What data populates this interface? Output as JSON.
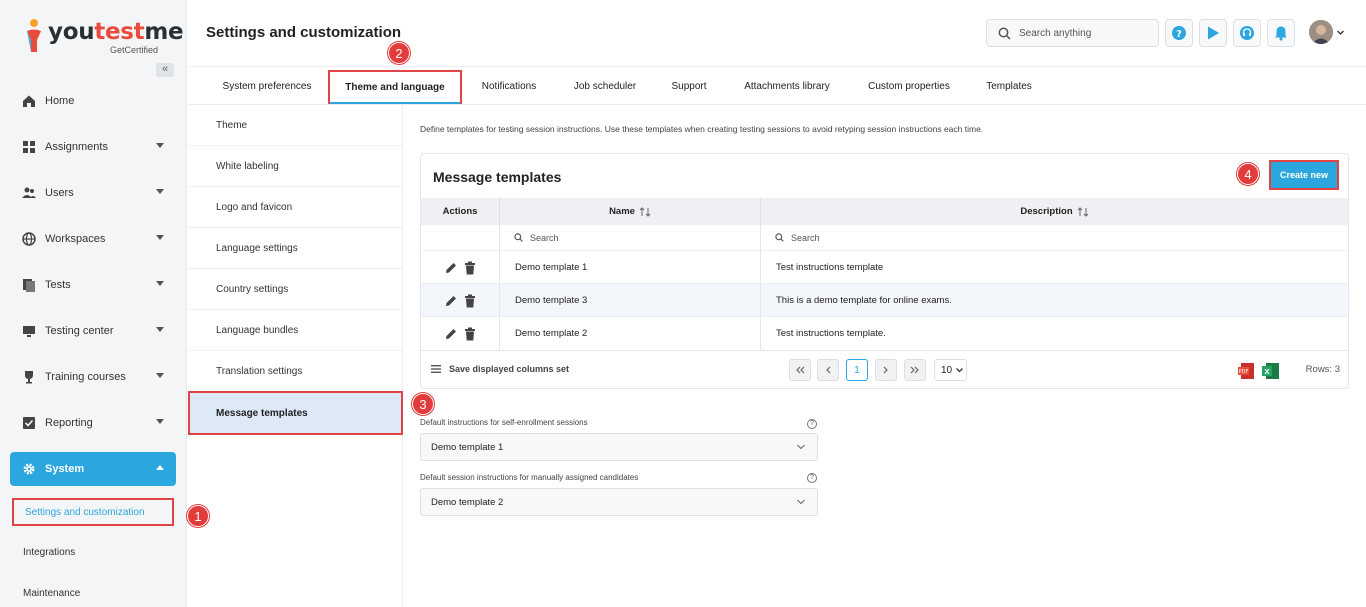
{
  "logo": {
    "text_a": "you",
    "text_b": "test",
    "text_c": "me",
    "sub": "GetCertified"
  },
  "sidebar": {
    "items": [
      {
        "label": "Home"
      },
      {
        "label": "Assignments"
      },
      {
        "label": "Users"
      },
      {
        "label": "Workspaces"
      },
      {
        "label": "Tests"
      },
      {
        "label": "Testing center"
      },
      {
        "label": "Training courses"
      },
      {
        "label": "Reporting"
      },
      {
        "label": "System"
      }
    ],
    "sub_items": [
      {
        "label": "Settings and customization"
      },
      {
        "label": "Integrations"
      },
      {
        "label": "Maintenance"
      }
    ]
  },
  "header": {
    "title": "Settings and customization",
    "search_placeholder": "Search anything"
  },
  "tabs": [
    {
      "label": "System preferences"
    },
    {
      "label": "Theme and language"
    },
    {
      "label": "Notifications"
    },
    {
      "label": "Job scheduler"
    },
    {
      "label": "Support"
    },
    {
      "label": "Attachments library"
    },
    {
      "label": "Custom properties"
    },
    {
      "label": "Templates"
    }
  ],
  "submenu": [
    {
      "label": "Theme"
    },
    {
      "label": "White labeling"
    },
    {
      "label": "Logo and favicon"
    },
    {
      "label": "Language settings"
    },
    {
      "label": "Country settings"
    },
    {
      "label": "Language bundles"
    },
    {
      "label": "Translation settings"
    },
    {
      "label": "Message templates"
    }
  ],
  "main": {
    "intro": "Define templates for testing session instructions. Use these templates when creating testing sessions to avoid retyping session instructions each time.",
    "panel_title": "Message templates",
    "create_label": "Create new",
    "columns": {
      "actions": "Actions",
      "name": "Name",
      "description": "Description"
    },
    "filter_placeholder": "Search",
    "rows": [
      {
        "name": "Demo template 1",
        "description": "Test instructions template"
      },
      {
        "name": "Demo template 3",
        "description": "This is a demo template for online exams."
      },
      {
        "name": "Demo template 2",
        "description": "Test instructions template."
      }
    ],
    "footer": {
      "save_columns": "Save displayed columns set",
      "current_page": "1",
      "page_size": "10",
      "rows_count": "Rows: 3"
    },
    "field1": {
      "label": "Default instructions for self-enrollment sessions",
      "value": "Demo template 1"
    },
    "field2": {
      "label": "Default session instructions for manually assigned candidates",
      "value": "Demo template 2"
    }
  },
  "badges": [
    "1",
    "2",
    "3",
    "4"
  ],
  "colors": {
    "accent": "#2ca6de",
    "highlight": "#e04444"
  }
}
